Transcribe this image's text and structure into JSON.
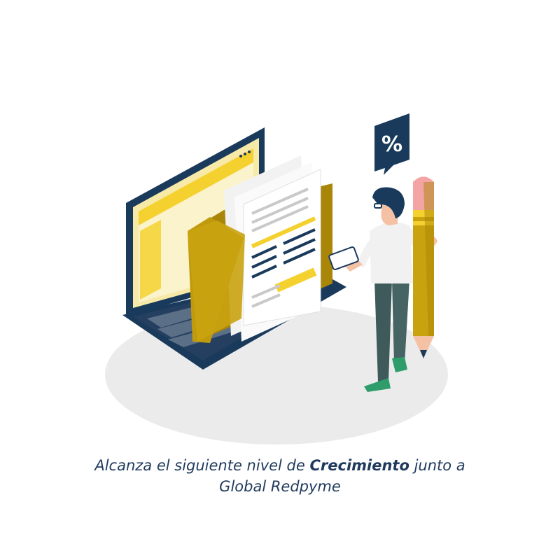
{
  "caption": {
    "line1_before": "Alcanza el siguiente nivel de ",
    "line1_emphasis": "Crecimiento",
    "line1_after": " junto a",
    "line2": "Global Redpyme"
  },
  "badge": {
    "symbol": "%",
    "icon": "percent-icon"
  },
  "colors": {
    "navy": "#1a3a5c",
    "yellow": "#f5d130",
    "gold": "#c19a0b",
    "floor": "#ebebeb",
    "text": "#1f3a5c",
    "shoe": "#2e9d6b",
    "pencil_tip": "#f4a4a4"
  }
}
